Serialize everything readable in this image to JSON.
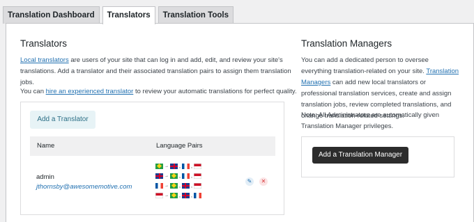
{
  "tabs": [
    {
      "label": "Translation Dashboard",
      "active": false
    },
    {
      "label": "Translators",
      "active": true
    },
    {
      "label": "Translation Tools",
      "active": false
    }
  ],
  "translators": {
    "title": "Translators",
    "intro_link": "Local translators",
    "intro_text": " are users of your site that can log in and add, edit, and review your site's translations. Add a translator and their associated translation pairs to assign them translation jobs.",
    "hire_prefix": "You can ",
    "hire_link": "hire an experienced translator",
    "hire_suffix": " to review your automatic translations for perfect quality.",
    "add_button": "Add a Translator",
    "columns": {
      "name": "Name",
      "pairs": "Language Pairs"
    },
    "rows": [
      {
        "name": "admin",
        "email": "jthornsby@awesomemotive.com",
        "pairs": [
          [
            "br",
            "gb",
            "fr",
            "id"
          ],
          [
            "gb",
            "br",
            "fr",
            "id"
          ],
          [
            "fr",
            "br",
            "gb",
            "id"
          ],
          [
            "id",
            "br",
            "gb",
            "fr"
          ]
        ]
      }
    ],
    "edit_icon": "pencil-icon",
    "delete_icon": "close-icon"
  },
  "managers": {
    "title": "Translation Managers",
    "desc_prefix": "You can add a dedicated person to oversee everything translation-related on your site. ",
    "desc_link": "Translation Managers",
    "desc_suffix": " can add new local translators or professional translation services, create and assign translation jobs, review completed translations, and change translation-related settings.",
    "note": "Note: All Administrators are automatically given Translation Manager privileges.",
    "add_button": "Add a Translation Manager"
  },
  "colors": {
    "link": "#2271b1",
    "accent_bg": "#e7f3f6",
    "dark_button": "#2c2c2c"
  }
}
